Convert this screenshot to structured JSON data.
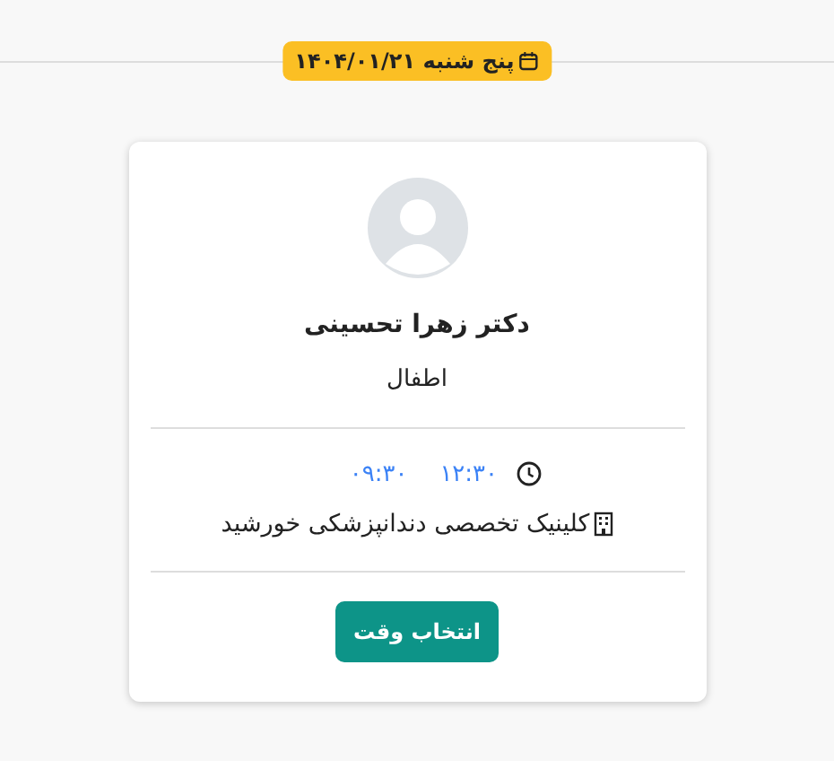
{
  "date_badge": {
    "text": "پنج شنبه ۱۴۰۴/۰۱/۲۱"
  },
  "doctor": {
    "name": "دکتر زهرا تحسینی",
    "specialty": "اطفال"
  },
  "times": [
    "۱۲:۳۰",
    "۰۹:۳۰"
  ],
  "clinic": "کلینیک تخصصی دندانپزشکی خورشید",
  "button": "انتخاب وقت"
}
